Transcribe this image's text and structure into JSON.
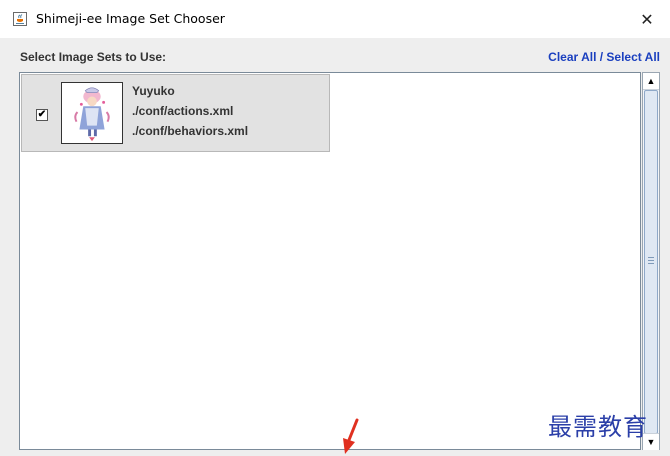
{
  "window": {
    "title": "Shimeji-ee Image Set Chooser",
    "close_glyph": "✕"
  },
  "header": {
    "select_label": "Select Image Sets to Use:",
    "clear_all": "Clear All",
    "separator": " / ",
    "select_all": "Select All",
    "link_color": "#1a3fbf"
  },
  "image_sets": [
    {
      "checked": true,
      "check_glyph": "✔",
      "name": "Yuyuko",
      "actions": "./conf/actions.xml",
      "behaviors": "./conf/behaviors.xml"
    }
  ],
  "scrollbar": {
    "up_glyph": "▲",
    "down_glyph": "▼"
  },
  "watermark": {
    "text": "最需教育"
  },
  "icons": {
    "app": "java-cup-icon",
    "close": "close-icon",
    "thumbnail": "character-thumbnail-icon",
    "arrow": "red-arrow-icon"
  }
}
